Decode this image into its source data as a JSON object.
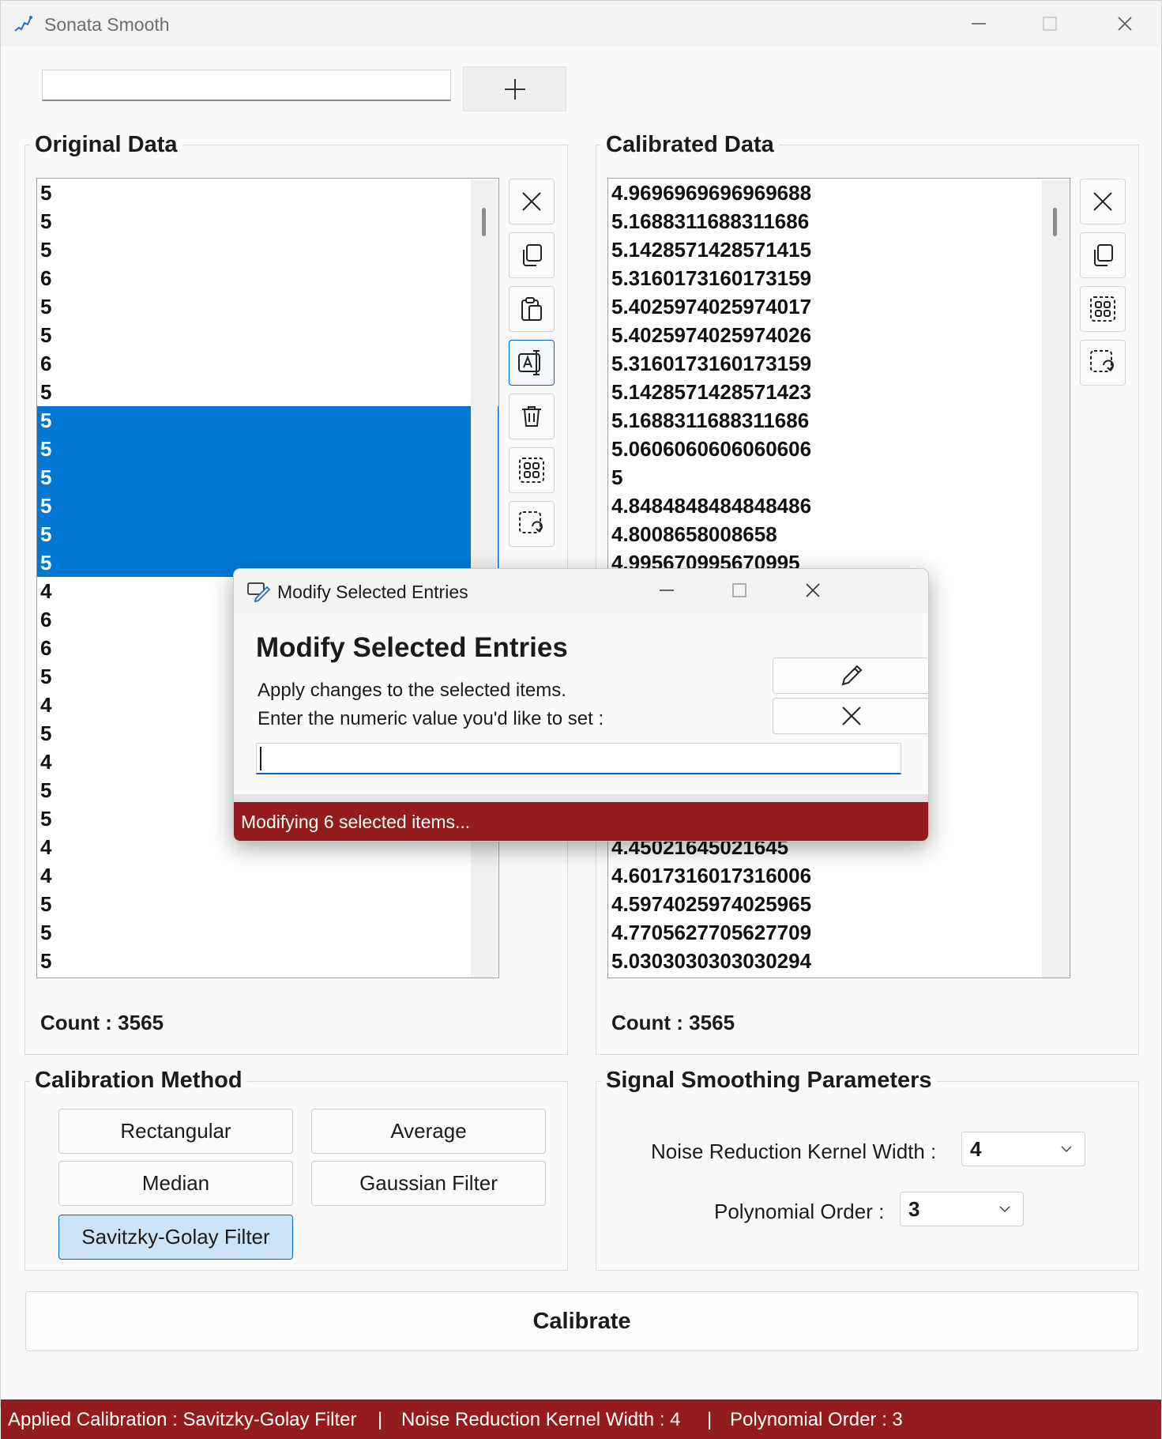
{
  "window": {
    "title": "Sonata Smooth"
  },
  "search": {
    "value": ""
  },
  "original": {
    "title": "Original Data",
    "items": [
      {
        "v": "5",
        "sel": false
      },
      {
        "v": "5",
        "sel": false
      },
      {
        "v": "5",
        "sel": false
      },
      {
        "v": "6",
        "sel": false
      },
      {
        "v": "5",
        "sel": false
      },
      {
        "v": "5",
        "sel": false
      },
      {
        "v": "6",
        "sel": false
      },
      {
        "v": "5",
        "sel": false
      },
      {
        "v": "5",
        "sel": true
      },
      {
        "v": "5",
        "sel": true
      },
      {
        "v": "5",
        "sel": true
      },
      {
        "v": "5",
        "sel": true
      },
      {
        "v": "5",
        "sel": true
      },
      {
        "v": "5",
        "sel": true
      },
      {
        "v": "4",
        "sel": false
      },
      {
        "v": "6",
        "sel": false
      },
      {
        "v": "6",
        "sel": false
      },
      {
        "v": "5",
        "sel": false
      },
      {
        "v": "4",
        "sel": false
      },
      {
        "v": "5",
        "sel": false
      },
      {
        "v": "4",
        "sel": false
      },
      {
        "v": "5",
        "sel": false
      },
      {
        "v": "5",
        "sel": false
      },
      {
        "v": "4",
        "sel": false
      },
      {
        "v": "4",
        "sel": false
      },
      {
        "v": "5",
        "sel": false
      },
      {
        "v": "5",
        "sel": false
      },
      {
        "v": "5",
        "sel": false
      }
    ],
    "count_label": "Count : 3565"
  },
  "calibrated": {
    "title": "Calibrated Data",
    "items": [
      "4.9696969696969688",
      "5.1688311688311686",
      "5.1428571428571415",
      "5.3160173160173159",
      "5.4025974025974017",
      "5.4025974025974026",
      "5.3160173160173159",
      "5.1428571428571423",
      "5.1688311688311686",
      "5.0606060606060606",
      "5",
      "4.8484848484848486",
      "4.8008658008658",
      "4.995670995670995",
      "",
      "",
      "",
      "",
      "",
      "",
      "",
      "",
      "",
      "4.45021645021645",
      "4.6017316017316006",
      "4.5974025974025965",
      "4.7705627705627709",
      "5.0303030303030294"
    ],
    "count_label": "Count : 3565"
  },
  "calibration_method": {
    "title": "Calibration Method",
    "buttons": [
      "Rectangular",
      "Average",
      "Median",
      "Gaussian Filter",
      "Savitzky-Golay Filter"
    ],
    "active": "Savitzky-Golay Filter"
  },
  "smoothing": {
    "title": "Signal Smoothing Parameters",
    "kernel_label": "Noise Reduction Kernel Width :",
    "kernel_value": "4",
    "order_label": "Polynomial Order :",
    "order_value": "3"
  },
  "calibrate_label": "Calibrate",
  "status": {
    "applied": "Applied Calibration :  Savitzky-Golay Filter",
    "sep1": "|",
    "kernel": "Noise Reduction Kernel Width :   4",
    "sep2": "|",
    "order": "Polynomial Order :   3"
  },
  "dialog": {
    "title": "Modify Selected Entries",
    "heading": "Modify Selected Entries",
    "line1": "Apply changes to the selected items.",
    "line2": "Enter the numeric value you'd like to set :",
    "input_value": "",
    "status": "Modifying 6 selected items..."
  },
  "icons": {
    "original_tools": [
      "close-icon",
      "copy-icon",
      "paste-icon",
      "rename-icon",
      "delete-icon",
      "select-all-icon",
      "invert-selection-icon"
    ],
    "calibrated_tools": [
      "close-icon",
      "copy-icon",
      "select-all-icon",
      "invert-selection-icon"
    ]
  },
  "colors": {
    "accent": "#0078d4",
    "status_bar": "#941b1e",
    "active_button": "#cce4f7"
  }
}
